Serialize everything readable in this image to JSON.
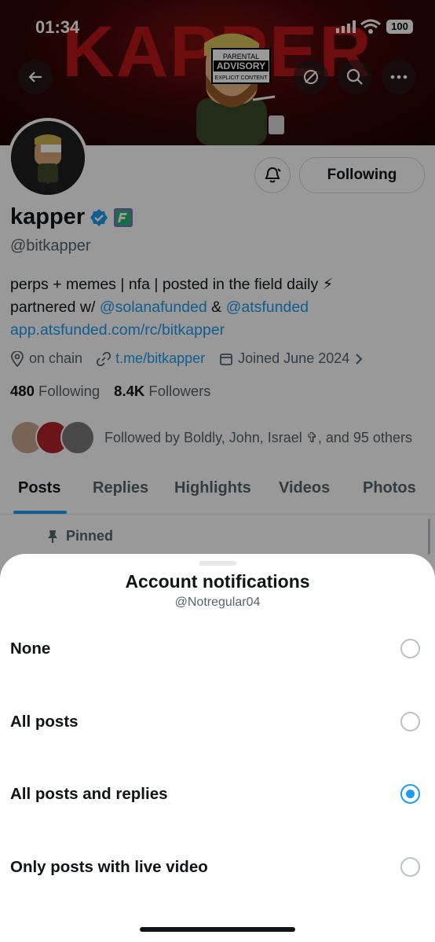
{
  "status_bar": {
    "time": "01:34",
    "battery": "100"
  },
  "banner": {
    "text": "KAPPER",
    "advisory_line1": "PARENTAL",
    "advisory_line2": "ADVISORY",
    "advisory_line3": "EXPLICIT CONTENT"
  },
  "profile": {
    "display_name": "kapper",
    "handle": "@bitkapper",
    "following_button": "Following",
    "bio_line1": "perps + memes | nfa | posted in the field daily ⚡",
    "bio_prefix": "partnered w/ ",
    "bio_mention1": "@solanafunded",
    "bio_amp": " & ",
    "bio_mention2": "@atsfunded",
    "bio_link": "app.atsfunded.com/rc/bitkapper",
    "location": "on chain",
    "website": "t.me/bitkapper",
    "joined": "Joined June 2024",
    "following_count": "480",
    "following_label": "Following",
    "followers_count": "8.4K",
    "followers_label": "Followers",
    "followed_by": "Followed by Boldly, John, Israel ✞, and 95 others"
  },
  "tabs": [
    "Posts",
    "Replies",
    "Highlights",
    "Videos",
    "Photos"
  ],
  "pinned_label": "Pinned",
  "sheet": {
    "title": "Account notifications",
    "subtitle": "@Notregular04",
    "options": [
      {
        "label": "None",
        "selected": false
      },
      {
        "label": "All posts",
        "selected": false
      },
      {
        "label": "All posts and replies",
        "selected": true
      },
      {
        "label": "Only posts with live video",
        "selected": false
      }
    ]
  },
  "colors": {
    "accent": "#1d9bf0",
    "banner_red": "#b81616",
    "text": "#0f1419",
    "muted": "#536471"
  }
}
